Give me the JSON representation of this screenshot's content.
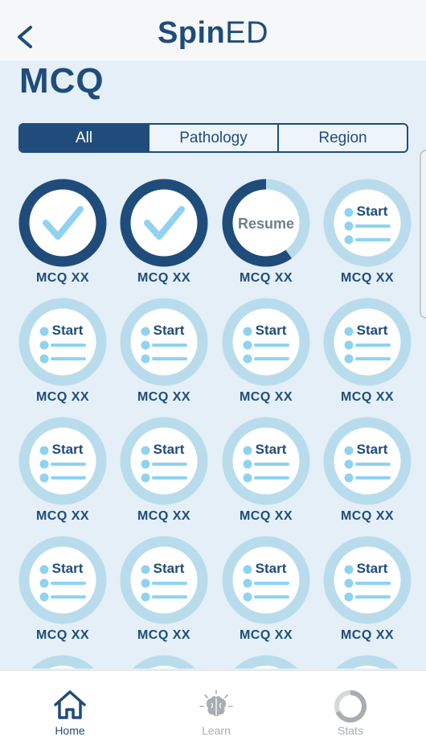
{
  "header": {
    "title_bold": "Spin",
    "title_light": "ED",
    "back_icon": "chevron-left-icon"
  },
  "page_title": "MCQ",
  "filter_tabs": [
    {
      "label": "All",
      "active": true
    },
    {
      "label": "Pathology",
      "active": false
    },
    {
      "label": "Region",
      "active": false
    }
  ],
  "quizzes": [
    {
      "label": "MCQ XX",
      "state": "completed"
    },
    {
      "label": "MCQ XX",
      "state": "completed"
    },
    {
      "label": "MCQ XX",
      "state": "in_progress",
      "action": "Resume",
      "progress": 0.6
    },
    {
      "label": "MCQ XX",
      "state": "new",
      "action": "Start"
    },
    {
      "label": "MCQ XX",
      "state": "new",
      "action": "Start"
    },
    {
      "label": "MCQ XX",
      "state": "new",
      "action": "Start"
    },
    {
      "label": "MCQ XX",
      "state": "new",
      "action": "Start"
    },
    {
      "label": "MCQ XX",
      "state": "new",
      "action": "Start"
    },
    {
      "label": "MCQ XX",
      "state": "new",
      "action": "Start"
    },
    {
      "label": "MCQ XX",
      "state": "new",
      "action": "Start"
    },
    {
      "label": "MCQ XX",
      "state": "new",
      "action": "Start"
    },
    {
      "label": "MCQ XX",
      "state": "new",
      "action": "Start"
    },
    {
      "label": "MCQ XX",
      "state": "new",
      "action": "Start"
    },
    {
      "label": "MCQ XX",
      "state": "new",
      "action": "Start"
    },
    {
      "label": "MCQ XX",
      "state": "new",
      "action": "Start"
    },
    {
      "label": "MCQ XX",
      "state": "new",
      "action": "Start"
    }
  ],
  "tabbar": [
    {
      "label": "Home",
      "icon": "home-icon",
      "active": true
    },
    {
      "label": "Learn",
      "icon": "brain-icon",
      "active": false
    },
    {
      "label": "Stats",
      "icon": "stats-ring-icon",
      "active": false
    }
  ],
  "colors": {
    "primary": "#1f4c7a",
    "ring_light": "#b9dcec",
    "accent_light": "#8fd3f0",
    "background": "#e4eff7",
    "resume_text": "#6f7f8c"
  }
}
